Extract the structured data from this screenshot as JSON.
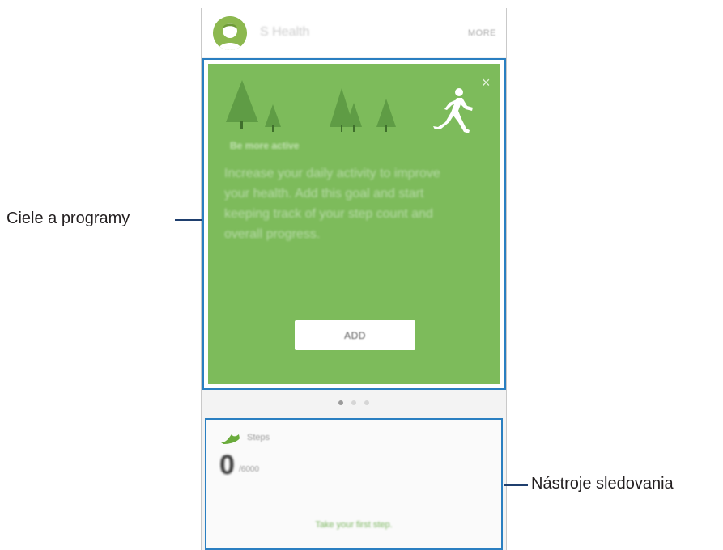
{
  "app": {
    "title": "S Health",
    "more_label": "MORE"
  },
  "goal_card": {
    "title": "Be more active",
    "description": "Increase your daily activity to improve your health. Add this goal and start keeping track of your step count and overall progress.",
    "add_label": "ADD",
    "close_glyph": "×",
    "card_color": "#7dbb5b"
  },
  "pager": {
    "pages": 3,
    "active_index": 0
  },
  "tracker": {
    "label": "Steps",
    "value": "0",
    "goal": "/6000",
    "prompt": "Take your first step."
  },
  "callouts": {
    "goals_programs": "Ciele a programy",
    "trackers": "Nástroje sledovania"
  },
  "colors": {
    "highlight_border": "#2a7fc1",
    "accent_green": "#8cb84f"
  },
  "icons": [
    "avatar-icon",
    "tree-icon",
    "runner-icon",
    "close-icon",
    "shoe-icon"
  ]
}
